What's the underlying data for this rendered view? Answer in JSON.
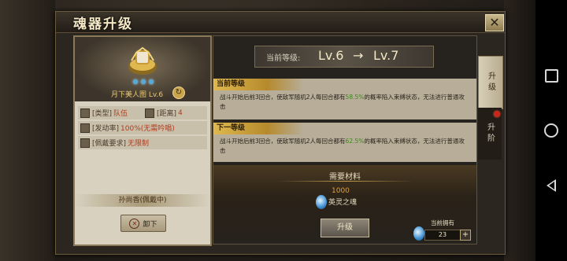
{
  "window": {
    "title": "魂器升级",
    "close_label": "✕"
  },
  "item": {
    "name": "月下美人图 Lv.6",
    "stars": 3,
    "refresh_label": "↻",
    "attrs": {
      "type_key": "[类型]",
      "type_val": "队伍",
      "range_key": "[距离]",
      "range_val": "4",
      "trigger_key": "[发动率]",
      "trigger_val": "100%(无需吟唱)",
      "equip_key": "[佩戴要求]",
      "equip_val": "无限制"
    },
    "owner": "孙尚香(佩戴中)",
    "unequip_label": "卸下"
  },
  "upgrade": {
    "level_label": "当前等级:",
    "level_from": "Lv.6",
    "level_arrow": "→",
    "level_to": "Lv.7",
    "current_head": "当前等级",
    "current_body_a": "战斗开始后前3回合，使敌军随机2人每回合都有",
    "current_rate": "58.5%",
    "current_body_b": "的概率陷入束缚状态，无法进行普通攻击",
    "next_head": "下一等级",
    "next_body_a": "战斗开始后前3回合，使敌军随机2人每回合都有",
    "next_rate": "62.5%",
    "next_body_b": "的概率陷入束缚状态，无法进行普通攻击",
    "mat_title": "需要材料",
    "mat_count": "1000",
    "mat_name": "英灵之魂",
    "up_button": "升级",
    "own_label": "当前拥有",
    "own_value": "23",
    "plus_label": "+"
  },
  "tabs": [
    {
      "label": "升级",
      "active": true
    },
    {
      "label": "升阶",
      "active": false
    }
  ],
  "colors": {
    "highlight_green": "#3a8a1a",
    "accent_gold": "#e0b850",
    "red_text": "#b23a1a"
  }
}
